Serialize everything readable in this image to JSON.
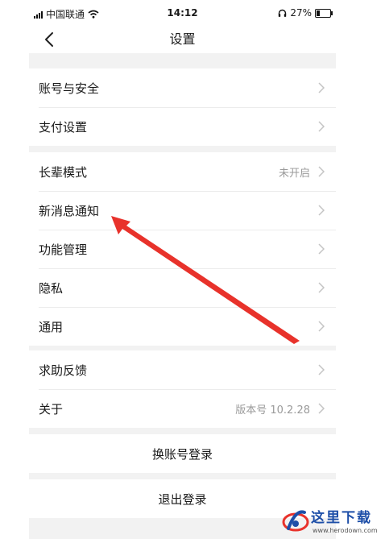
{
  "status_bar": {
    "carrier": "中国联通",
    "time": "14:12",
    "battery_percent": "27%",
    "battery_level": 0.27
  },
  "header": {
    "back_icon": "chevron-left-icon",
    "title": "设置"
  },
  "groups": [
    {
      "items": [
        {
          "label": "账号与安全",
          "value": ""
        },
        {
          "label": "支付设置",
          "value": ""
        }
      ]
    },
    {
      "items": [
        {
          "label": "长辈模式",
          "value": "未开启"
        },
        {
          "label": "新消息通知",
          "value": ""
        },
        {
          "label": "功能管理",
          "value": ""
        },
        {
          "label": "隐私",
          "value": ""
        },
        {
          "label": "通用",
          "value": ""
        }
      ]
    },
    {
      "items": [
        {
          "label": "求助反馈",
          "value": ""
        },
        {
          "label": "关于",
          "value": "版本号 10.2.28"
        }
      ]
    }
  ],
  "actions": {
    "switch_account": "换账号登录",
    "logout": "退出登录"
  },
  "annotation": {
    "arrow_color": "#e8322b",
    "points_to": "新消息通知"
  },
  "watermark": {
    "text": "这里下载",
    "url": "www.herodown.com"
  }
}
